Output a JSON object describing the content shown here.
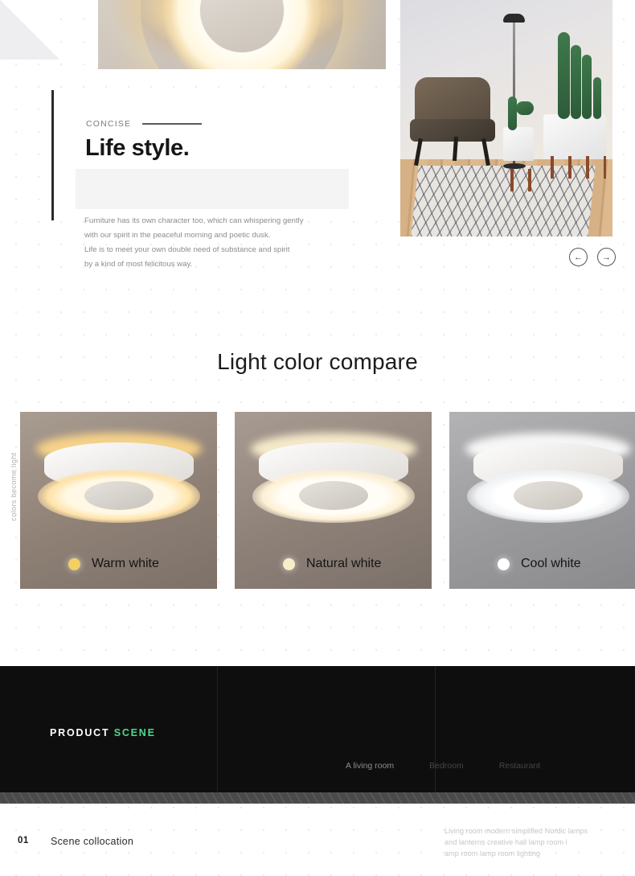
{
  "hero": {
    "kicker": "CONCISE",
    "title": "Life style.",
    "body_lines": [
      "Furniture has its own character too, which can whispering gently",
      "with our spirit in the peaceful morning and poetic dusk.",
      "Life is to meet your own double need of substance and spirit",
      "by a kind of most felicitous way."
    ],
    "prev_arrow": "←",
    "next_arrow": "→"
  },
  "compare": {
    "title": "Light color compare",
    "side_label": "colors become light",
    "cards": [
      {
        "label": "Warm white",
        "dot_color": "#f5cf63",
        "scene_bg": "linear-gradient(160deg,#a99c90 0%,#8e8075 55%,#7d7168 100%)",
        "glow": "#ffd98a",
        "rim": "radial-gradient(ellipse at 50% 50%, #fff8e4 0 46%, #ffe2a8 62%, rgba(255,214,140,0) 80%)"
      },
      {
        "label": "Natural white",
        "dot_color": "#f7eec8",
        "scene_bg": "linear-gradient(160deg,#a89c92 0%,#8d8178 55%,#7c7169 100%)",
        "glow": "#fff3d2",
        "rim": "radial-gradient(ellipse at 50% 50%, #fffdf6 0 46%, #fdf0d4 62%, rgba(253,240,212,0) 80%)"
      },
      {
        "label": "Cool white",
        "dot_color": "#ffffff",
        "scene_bg": "linear-gradient(160deg,#b3b3b5 0%,#9a9a9d 55%,#8a8a8d 100%)",
        "glow": "#ffffff",
        "rim": "radial-gradient(ellipse at 50% 50%, #ffffff 0 46%, #f0f2f4 62%, rgba(240,242,244,0) 80%)"
      }
    ]
  },
  "dark_section": {
    "brand_primary": "PRODUCT",
    "brand_accent": "SCENE",
    "accent_color": "#4fd98a",
    "scenes": [
      {
        "label": "A living room",
        "active": true
      },
      {
        "label": "Bedroom",
        "active": false
      },
      {
        "label": "Restaurant",
        "active": false
      }
    ]
  },
  "footer": {
    "number": "01",
    "title": "Scene  collocation",
    "description_lines": [
      "Living room modern simplified Nordic lamps",
      "and lanterns creative hall lamp room l",
      "amp room lamp room lighting"
    ]
  }
}
